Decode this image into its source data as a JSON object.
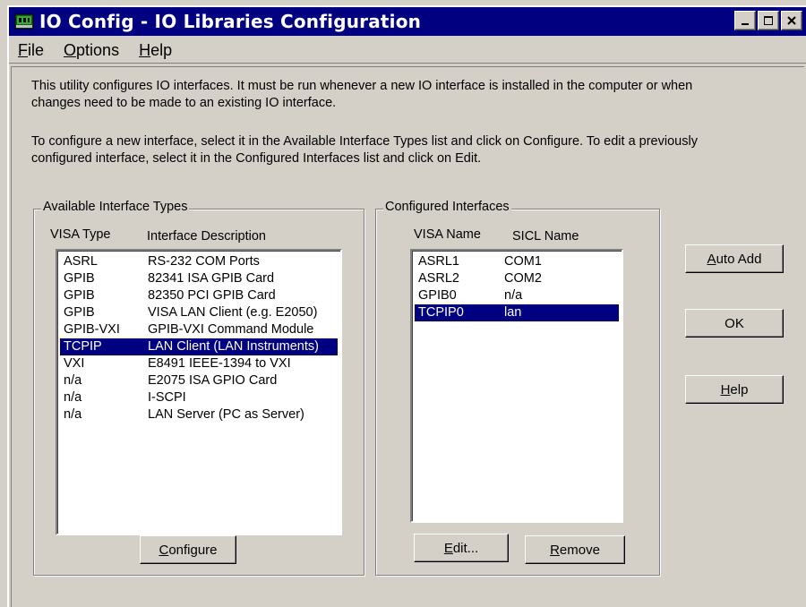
{
  "window": {
    "title": "IO Config - IO Libraries Configuration"
  },
  "menu": {
    "file": {
      "first": "F",
      "rest": "ile"
    },
    "options": {
      "first": "O",
      "rest": "ptions"
    },
    "help": {
      "first": "H",
      "rest": "elp"
    }
  },
  "description": {
    "line1": "This utility configures IO interfaces.  It must be run whenever a new IO interface is installed in the computer or when",
    "line2": "changes need to be made to an existing IO interface.",
    "line3": "To configure a new interface, select it in the Available Interface Types list and click on Configure.  To edit a previously",
    "line4": "configured interface, select it in the Configured Interfaces list and click on Edit."
  },
  "available": {
    "title": "Available Interface Types",
    "col_type": "VISA Type",
    "col_desc": "Interface Description",
    "rows": [
      {
        "type": "ASRL",
        "desc": "RS-232 COM Ports"
      },
      {
        "type": "GPIB",
        "desc": "82341 ISA GPIB Card"
      },
      {
        "type": "GPIB",
        "desc": "82350 PCI GPIB Card"
      },
      {
        "type": "GPIB",
        "desc": "VISA LAN Client (e.g. E2050)"
      },
      {
        "type": "GPIB-VXI",
        "desc": "GPIB-VXI Command Module"
      },
      {
        "type": "TCPIP",
        "desc": "LAN Client (LAN Instruments)"
      },
      {
        "type": "VXI",
        "desc": "E8491 IEEE-1394 to VXI"
      },
      {
        "type": "n/a",
        "desc": "E2075 ISA GPIO Card"
      },
      {
        "type": "n/a",
        "desc": "I-SCPI"
      },
      {
        "type": "n/a",
        "desc": "LAN Server (PC as Server)"
      }
    ],
    "selected_index": 5,
    "configure": {
      "first": "C",
      "rest": "onfigure"
    }
  },
  "configured": {
    "title": "Configured Interfaces",
    "col_visa": "VISA Name",
    "col_sicl": "SICL Name",
    "rows": [
      {
        "visa": "ASRL1",
        "sicl": "COM1"
      },
      {
        "visa": "ASRL2",
        "sicl": "COM2"
      },
      {
        "visa": "GPIB0",
        "sicl": "n/a"
      },
      {
        "visa": "TCPIP0",
        "sicl": "lan"
      }
    ],
    "selected_index": 3,
    "edit": {
      "first": "E",
      "rest": "dit..."
    },
    "remove": {
      "first": "R",
      "rest": "emove"
    }
  },
  "buttons": {
    "auto_add": {
      "first": "A",
      "rest": "uto Add"
    },
    "ok": "OK",
    "help": {
      "first": "H",
      "rest": "elp"
    }
  },
  "colors": {
    "titlebar": "#000080",
    "face": "#d4d0c8",
    "selection": "#000080"
  },
  "icons": [
    "app-icon",
    "minimize-icon",
    "maximize-icon",
    "close-icon"
  ]
}
